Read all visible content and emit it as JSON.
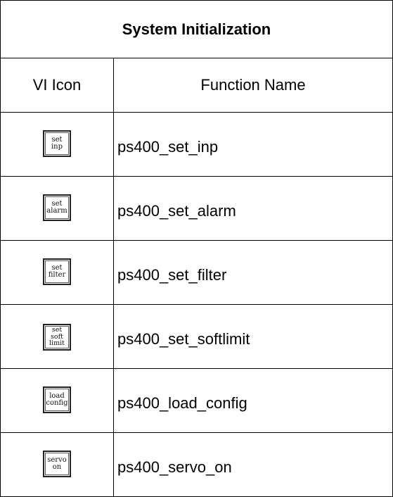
{
  "table": {
    "title": "System Initialization",
    "headers": {
      "icon": "VI Icon",
      "name": "Function Name"
    },
    "rows": [
      {
        "icon_label": "set\ninp",
        "function_name": "ps400_set_inp"
      },
      {
        "icon_label": "set\nalarm",
        "function_name": "ps400_set_alarm"
      },
      {
        "icon_label": "set\nfilter",
        "function_name": "ps400_set_filter"
      },
      {
        "icon_label": "set\nsoft\nlimit",
        "function_name": "ps400_set_softlimit"
      },
      {
        "icon_label": "load\nconfig",
        "function_name": "ps400_load_config"
      },
      {
        "icon_label": "servo\non",
        "function_name": "ps400_servo_on"
      }
    ]
  }
}
